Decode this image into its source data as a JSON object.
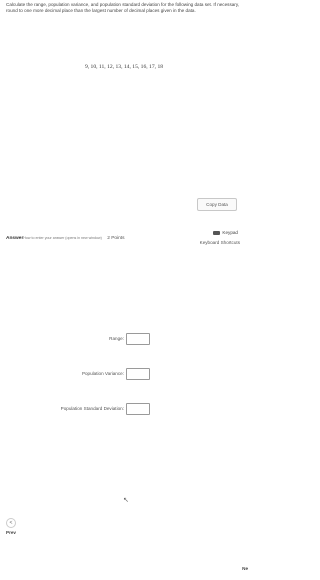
{
  "question": {
    "text": "Calculate the range, population variance, and population standard deviation for the following data set. If necessary, round to one more decimal place than the largest number of decimal places given in the data.",
    "dataset": "9, 10, 11, 12, 13, 14, 15, 16, 17, 18"
  },
  "copy_button_label": "Copy Data",
  "answer": {
    "label": "Answer",
    "hint": "How to enter your answer (opens in new window)",
    "points": "2 Points"
  },
  "keypad": {
    "label": "Keypad",
    "shortcuts": "Keyboard Shortcuts"
  },
  "fields": [
    {
      "label": "Range:",
      "value": ""
    },
    {
      "label": "Population Variance:",
      "value": ""
    },
    {
      "label": "Population Standard Deviation:",
      "value": ""
    }
  ],
  "nav": {
    "prev_label": "Prev",
    "prev_icon": "<",
    "next_label": "Ne"
  },
  "cursor_icon": "↖"
}
